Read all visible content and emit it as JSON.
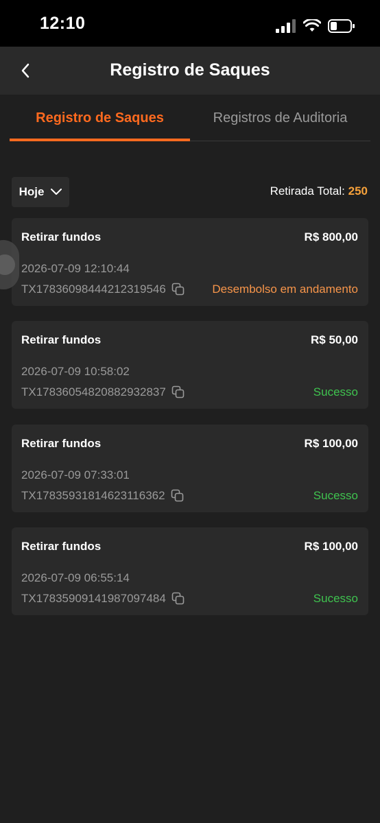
{
  "status_bar": {
    "time": "12:10"
  },
  "header": {
    "title": "Registro de Saques"
  },
  "tabs": [
    {
      "label": "Registro de Saques",
      "active": true
    },
    {
      "label": "Registros de Auditoria",
      "active": false
    }
  ],
  "filter": {
    "selected": "Hoje"
  },
  "total": {
    "label": "Retirada Total:",
    "value": "250"
  },
  "records": [
    {
      "title": "Retirar fundos",
      "amount": "R$ 800,00",
      "datetime": "2026-07-09 12:10:44",
      "tx": "TX17836098444212319546",
      "status": "Desembolso em andamento",
      "status_type": "pending"
    },
    {
      "title": "Retirar fundos",
      "amount": "R$ 50,00",
      "datetime": "2026-07-09 10:58:02",
      "tx": "TX17836054820882932837",
      "status": "Sucesso",
      "status_type": "success"
    },
    {
      "title": "Retirar fundos",
      "amount": "R$ 100,00",
      "datetime": "2026-07-09 07:33:01",
      "tx": "TX17835931814623116362",
      "status": "Sucesso",
      "status_type": "success"
    },
    {
      "title": "Retirar fundos",
      "amount": "R$ 100,00",
      "datetime": "2026-07-09 06:55:14",
      "tx": "TX17835909141987097484",
      "status": "Sucesso",
      "status_type": "success"
    }
  ],
  "colors": {
    "accent": "#ff6a1f",
    "total_value": "#f7a23b",
    "pending": "#f7954a",
    "success": "#3fc34f"
  },
  "icons": {
    "back": "chevron-left-icon",
    "dropdown": "chevron-down-icon",
    "copy": "copy-icon",
    "signal": "cellular-signal-icon",
    "wifi": "wifi-icon",
    "battery": "battery-icon"
  }
}
